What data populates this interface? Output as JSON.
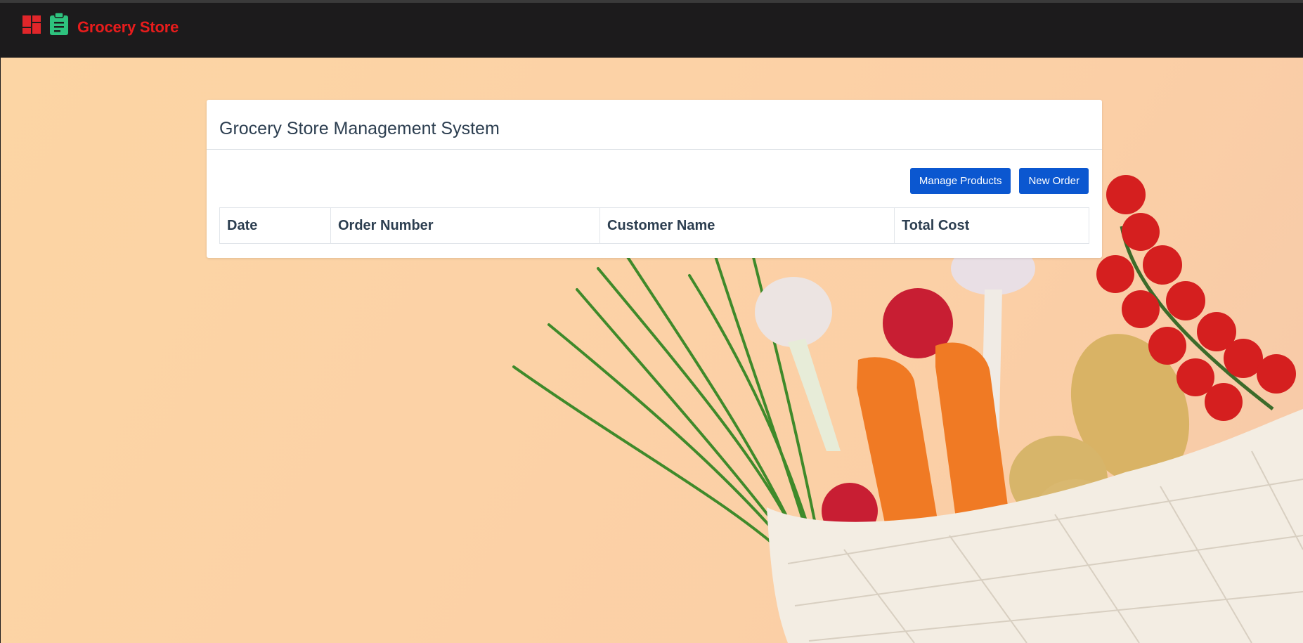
{
  "navbar": {
    "brand_text": "Grocery Store",
    "icons": [
      "dashboard-icon",
      "clipboard-icon"
    ],
    "brand_color": "#e81c1c",
    "clipboard_color": "#2ec27e",
    "background": "#1c1b1c"
  },
  "card": {
    "title": "Grocery Store Management System",
    "buttons": {
      "manage_products": "Manage Products",
      "new_order": "New Order"
    },
    "button_color": "#0b57d0",
    "table": {
      "headers": [
        "Date",
        "Order Number",
        "Customer Name",
        "Total Cost"
      ],
      "rows": []
    }
  },
  "background": {
    "description_colors": {
      "peach": "#fcd3a5"
    }
  }
}
